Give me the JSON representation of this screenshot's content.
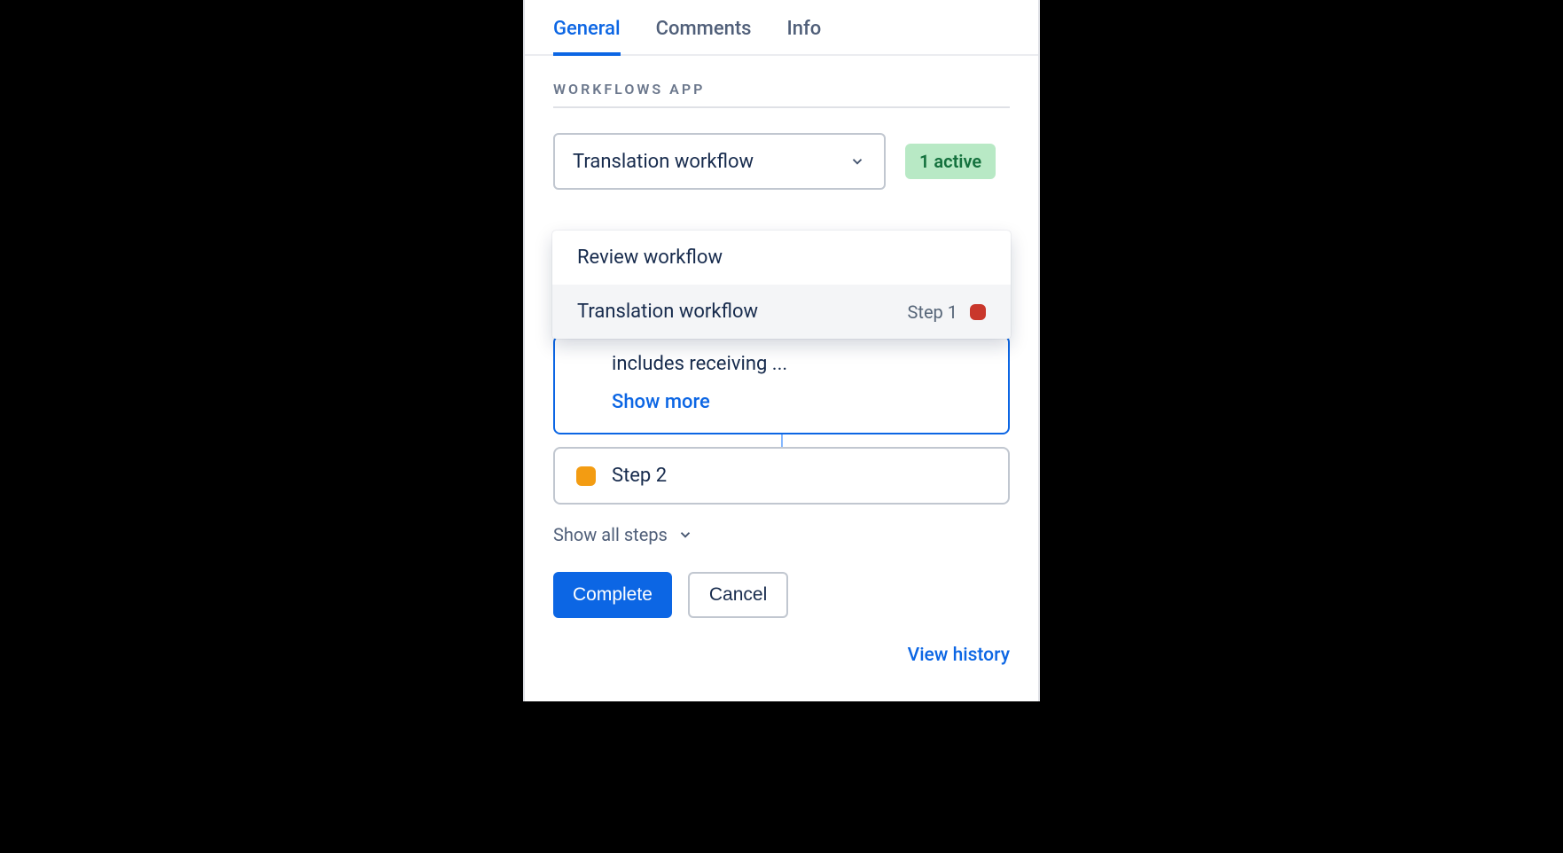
{
  "tabs": {
    "general": "General",
    "comments": "Comments",
    "info": "Info"
  },
  "section_title": "WORKFLOWS APP",
  "select": {
    "value": "Translation workflow"
  },
  "badge": "1 active",
  "dropdown": {
    "items": [
      {
        "label": "Review workflow"
      },
      {
        "label": "Translation workflow",
        "step": "Step 1",
        "status_color": "#c9372c"
      }
    ]
  },
  "current_step": {
    "truncated_text": "includes receiving ...",
    "show_more": "Show more"
  },
  "step2": {
    "label": "Step 2"
  },
  "show_all": "Show all steps",
  "buttons": {
    "complete": "Complete",
    "cancel": "Cancel"
  },
  "footer": {
    "view_history": "View history"
  }
}
